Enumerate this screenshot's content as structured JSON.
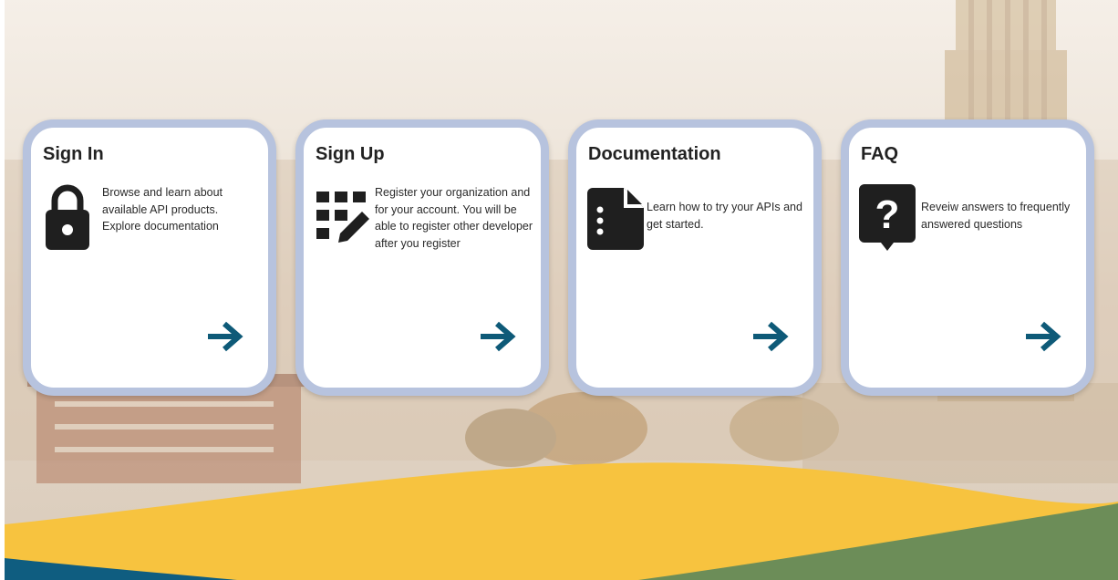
{
  "cards": [
    {
      "title": "Sign In",
      "text": "Browse and learn about available API products. Explore documentation",
      "icon": "lock-icon",
      "action": "arrow-right-icon"
    },
    {
      "title": "Sign Up",
      "text": "Register your organization and for your account. You will be able to register other developer after you register",
      "icon": "register-grid-pencil-icon",
      "action": "arrow-right-icon"
    },
    {
      "title": "Documentation",
      "text": "Learn how to try your APIs and get started.",
      "icon": "document-icon",
      "action": "arrow-right-icon"
    },
    {
      "title": "FAQ",
      "text": "Reveiw answers to frequently answered questions",
      "icon": "question-bubble-icon",
      "action": "arrow-right-icon"
    }
  ],
  "colors": {
    "card_border": "#b7c3de",
    "arrow": "#0e5a78",
    "icon": "#1f1f1f",
    "wave_gold": "#f7c33f",
    "wave_green": "#6c8d58",
    "wave_teal": "#0f5d80"
  }
}
